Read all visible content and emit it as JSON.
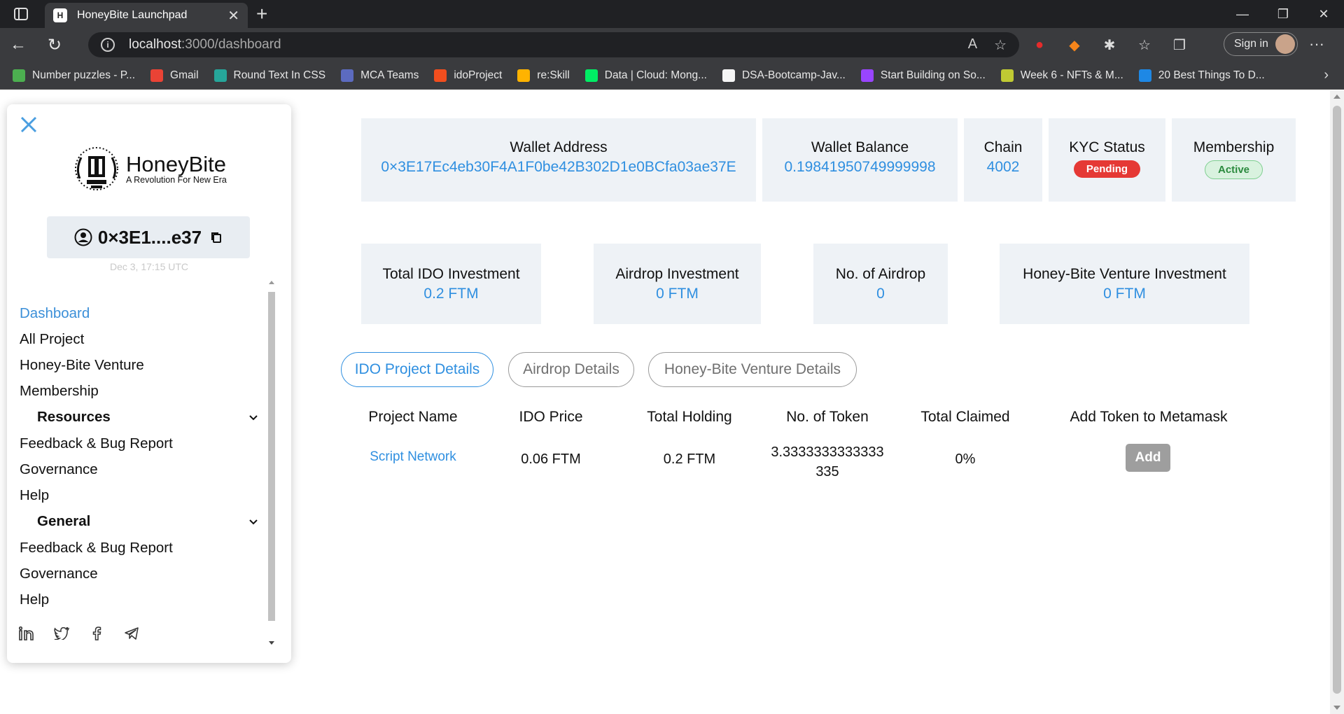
{
  "browser": {
    "tab_title": "HoneyBite Launchpad",
    "url_host": "localhost",
    "url_path": ":3000/dashboard",
    "signin_label": "Sign in",
    "bookmarks": [
      {
        "label": "Number puzzles - P...",
        "color": "#4caf50"
      },
      {
        "label": "Gmail",
        "color": "#ea4335"
      },
      {
        "label": "Round Text In CSS",
        "color": "#26a69a"
      },
      {
        "label": "MCA Teams",
        "color": "#5c6bc0"
      },
      {
        "label": "idoProject",
        "color": "#f24e1e"
      },
      {
        "label": "re:Skill",
        "color": "#ffb300"
      },
      {
        "label": "Data | Cloud: Mong...",
        "color": "#00ed64"
      },
      {
        "label": "DSA-Bootcamp-Jav...",
        "color": "#f5f5f5"
      },
      {
        "label": "Start Building on So...",
        "color": "#9945ff"
      },
      {
        "label": "Week 6 - NFTs & M...",
        "color": "#c0ca33"
      },
      {
        "label": "20 Best Things To D...",
        "color": "#1e88e5"
      }
    ]
  },
  "sidebar": {
    "logo_title": "HoneyBite",
    "logo_subtitle": "A Revolution For New Era",
    "wallet_short": "0×3E1....e37",
    "date": "Dec 3, 17:15 UTC",
    "menu_top": [
      "Dashboard",
      "All Project",
      "Honey-Bite Venture",
      "Membership"
    ],
    "section_resources": "Resources",
    "resources_items": [
      "Feedback & Bug Report",
      "Governance",
      "Help"
    ],
    "section_general": "General",
    "general_items": [
      "Feedback & Bug Report",
      "Governance",
      "Help"
    ]
  },
  "cards_top": {
    "wallet_address_label": "Wallet Address",
    "wallet_address_value": "0×3E17Ec4eb30F4A1F0be42B302D1e0BCfa03ae37E",
    "wallet_balance_label": "Wallet Balance",
    "wallet_balance_value": "0.19841950749999998",
    "chain_label": "Chain",
    "chain_value": "4002",
    "kyc_label": "KYC Status",
    "kyc_value": "Pending",
    "membership_label": "Membership",
    "membership_value": "Active"
  },
  "cards_invest": {
    "ido_label": "Total IDO Investment",
    "ido_value": "0.2 FTM",
    "airdrop_label": "Airdrop Investment",
    "airdrop_value": "0 FTM",
    "num_airdrop_label": "No. of Airdrop",
    "num_airdrop_value": "0",
    "venture_label": "Honey-Bite Venture Investment",
    "venture_value": "0 FTM"
  },
  "tabs": [
    "IDO Project Details",
    "Airdrop Details",
    "Honey-Bite Venture Details"
  ],
  "table": {
    "headers": [
      "Project Name",
      "IDO Price",
      "Total Holding",
      "No. of Token",
      "Total Claimed",
      "Add Token to Metamask"
    ],
    "row": {
      "project_name": "Script Network",
      "ido_price": "0.06 FTM",
      "total_holding": "0.2 FTM",
      "tokens_line1": "3.3333333333333",
      "tokens_line2": "335",
      "total_claimed": "0%",
      "add_label": "Add"
    }
  },
  "colors": {
    "accent": "#2f8fe0",
    "card_bg": "#eef2f6",
    "pending": "#e53935",
    "active": "#2b8a3e"
  }
}
